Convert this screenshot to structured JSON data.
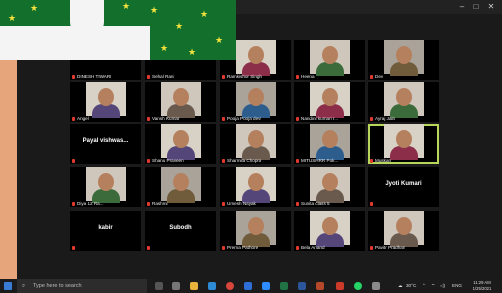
{
  "window": {
    "controls": [
      "–",
      "□",
      "✕"
    ]
  },
  "tiles": [
    {
      "name": "DINESH TIWARI",
      "r": 0,
      "c": 0,
      "video": false
    },
    {
      "name": "Sehal Rani",
      "r": 0,
      "c": 1,
      "video": false
    },
    {
      "name": "Ramkishor Singh",
      "r": 0,
      "c": 2,
      "video": true
    },
    {
      "name": "Heena",
      "r": 0,
      "c": 3,
      "video": true
    },
    {
      "name": "Dev",
      "r": 0,
      "c": 4,
      "video": true
    },
    {
      "name": "Angel",
      "r": 1,
      "c": 0,
      "video": true
    },
    {
      "name": "Vansh Kumar",
      "r": 1,
      "c": 1,
      "video": true
    },
    {
      "name": "Pooja Pooja devi",
      "r": 1,
      "c": 2,
      "video": true
    },
    {
      "name": "Nandini kumari r...",
      "r": 1,
      "c": 3,
      "video": true
    },
    {
      "name": "Ayraj Jain",
      "r": 1,
      "c": 4,
      "video": true
    },
    {
      "name": "Payal vishwas...",
      "r": 2,
      "c": 0,
      "big": true
    },
    {
      "name": "Shanu Praveen",
      "r": 2,
      "c": 1,
      "video": true
    },
    {
      "name": "Sharmila Chopra",
      "r": 2,
      "c": 2,
      "video": true
    },
    {
      "name": "MITUSHRR Pok...",
      "r": 2,
      "c": 3,
      "video": true
    },
    {
      "name": "Muskan",
      "r": 2,
      "c": 4,
      "video": true,
      "highlight": true
    },
    {
      "name": "Diya 12 Ra...",
      "r": 3,
      "c": 0,
      "video": true
    },
    {
      "name": "Rashmi",
      "r": 3,
      "c": 1,
      "video": true
    },
    {
      "name": "Umesh Nayak",
      "r": 3,
      "c": 2,
      "video": true
    },
    {
      "name": "Sunita class 5",
      "r": 3,
      "c": 3,
      "video": true
    },
    {
      "name": "Jyoti Kumari",
      "r": 3,
      "c": 4,
      "big": true
    },
    {
      "name": "kabir",
      "r": 4,
      "c": 0,
      "big": true
    },
    {
      "name": "Subodh",
      "r": 4,
      "c": 1,
      "big": true
    },
    {
      "name": "Prerna Pathore",
      "r": 4,
      "c": 2,
      "video": true
    },
    {
      "name": "Bela Anand",
      "r": 4,
      "c": 3,
      "video": true
    },
    {
      "name": "Pavitr Pradhan",
      "r": 4,
      "c": 4,
      "video": true
    }
  ],
  "taskbar": {
    "search_placeholder": "Type here to search",
    "weather": "30°C",
    "time": "11:29 AM",
    "date": "1/25/2021",
    "tray": "ENG"
  }
}
